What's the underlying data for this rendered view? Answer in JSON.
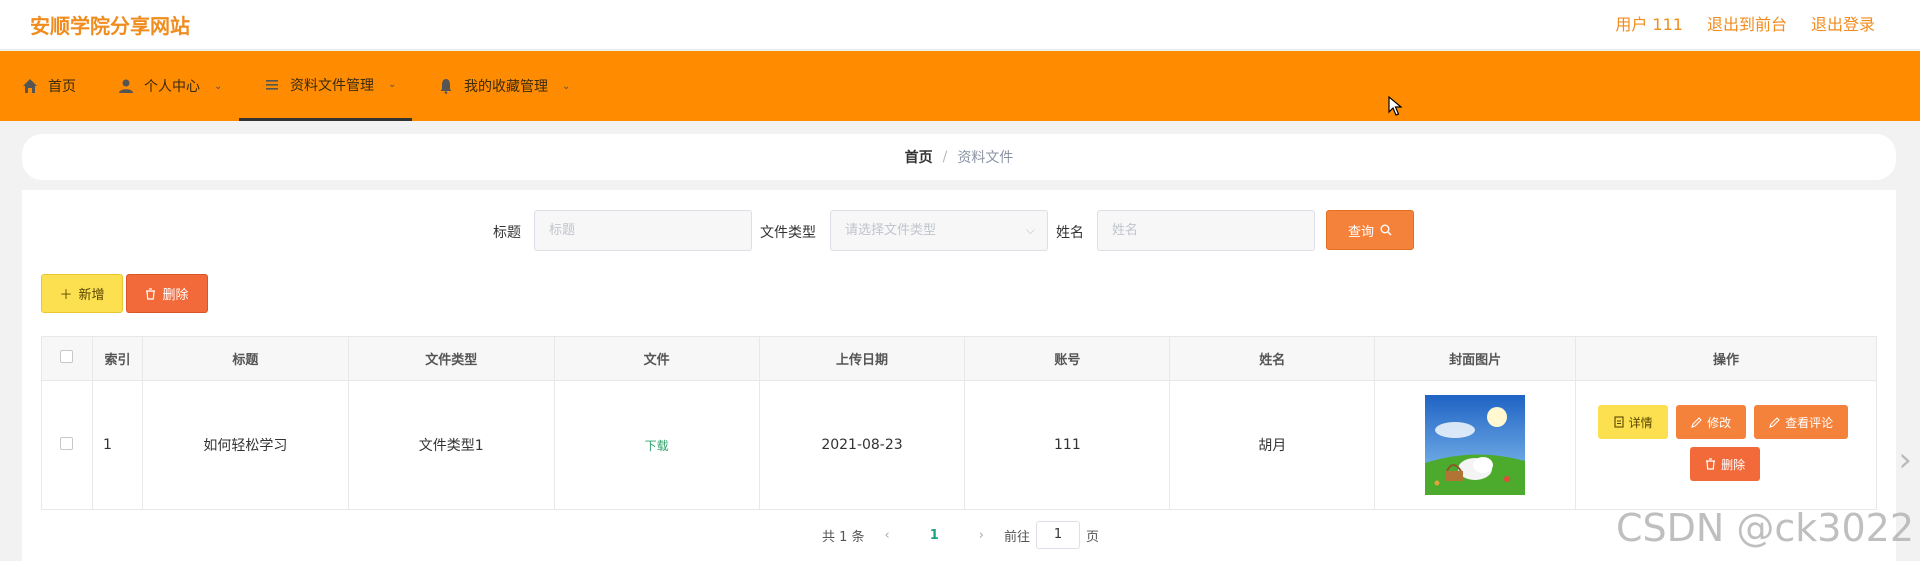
{
  "header": {
    "site_title": "安顺学院分享网站",
    "user_label": "用户 111",
    "exit_front_label": "退出到前台",
    "logout_label": "退出登录"
  },
  "nav": {
    "items": [
      {
        "label": "首页",
        "icon": "home-icon"
      },
      {
        "label": "个人中心",
        "icon": "user-icon"
      },
      {
        "label": "资料文件管理",
        "icon": "list-icon",
        "active": true
      },
      {
        "label": "我的收藏管理",
        "icon": "bell-icon"
      }
    ]
  },
  "breadcrumb": {
    "home": "首页",
    "separator": "/",
    "current": "资料文件"
  },
  "search": {
    "title_label": "标题",
    "title_placeholder": "标题",
    "type_label": "文件类型",
    "type_placeholder": "请选择文件类型",
    "name_label": "姓名",
    "name_placeholder": "姓名",
    "query_label": "查询"
  },
  "actions": {
    "add_label": "新增",
    "delete_label": "删除"
  },
  "table": {
    "headers": [
      "索引",
      "标题",
      "文件类型",
      "文件",
      "上传日期",
      "账号",
      "姓名",
      "封面图片",
      "操作"
    ],
    "rows": [
      {
        "index": "1",
        "title": "如何轻松学习",
        "type": "文件类型1",
        "file": "下载",
        "date": "2021-08-23",
        "account": "111",
        "name": "胡月",
        "ops": {
          "detail": "详情",
          "edit": "修改",
          "comments": "查看评论",
          "remove": "删除"
        }
      }
    ]
  },
  "pagination": {
    "total": "共 1 条",
    "current_page": "1",
    "goto_label": "前往",
    "goto_value": "1",
    "page_unit": "页"
  },
  "watermark": "CSDN @ck3022",
  "colors": {
    "accent": "#ff8c00",
    "title": "#f08c1e",
    "yellow_button": "#fce050",
    "orange_button": "#f5823a",
    "red_button": "#f26a3a",
    "link_green": "#2fa36b"
  }
}
